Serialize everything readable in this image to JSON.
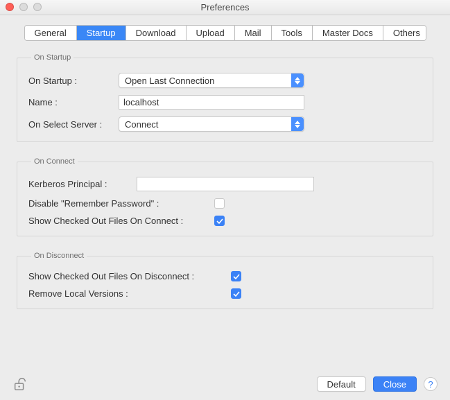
{
  "window": {
    "title": "Preferences"
  },
  "tabs": {
    "general": "General",
    "startup": "Startup",
    "download": "Download",
    "upload": "Upload",
    "mail": "Mail",
    "tools": "Tools",
    "master_docs": "Master Docs",
    "others": "Others",
    "active": "startup"
  },
  "groups": {
    "on_startup": {
      "legend": "On Startup",
      "on_startup_label": "On Startup :",
      "on_startup_value": "Open Last Connection",
      "name_label": "Name :",
      "name_value": "localhost",
      "on_select_label": "On Select Server :",
      "on_select_value": "Connect"
    },
    "on_connect": {
      "legend": "On Connect",
      "kerberos_label": "Kerberos Principal :",
      "kerberos_value": "",
      "disable_remember_label": "Disable \"Remember Password\" :",
      "disable_remember_checked": false,
      "show_checked_connect_label": "Show Checked Out Files On Connect :",
      "show_checked_connect_checked": true
    },
    "on_disconnect": {
      "legend": "On Disconnect",
      "show_checked_disconnect_label": "Show Checked Out Files On Disconnect :",
      "show_checked_disconnect_checked": true,
      "remove_local_label": "Remove Local Versions :",
      "remove_local_checked": true
    }
  },
  "footer": {
    "default": "Default",
    "close": "Close",
    "help": "?"
  }
}
